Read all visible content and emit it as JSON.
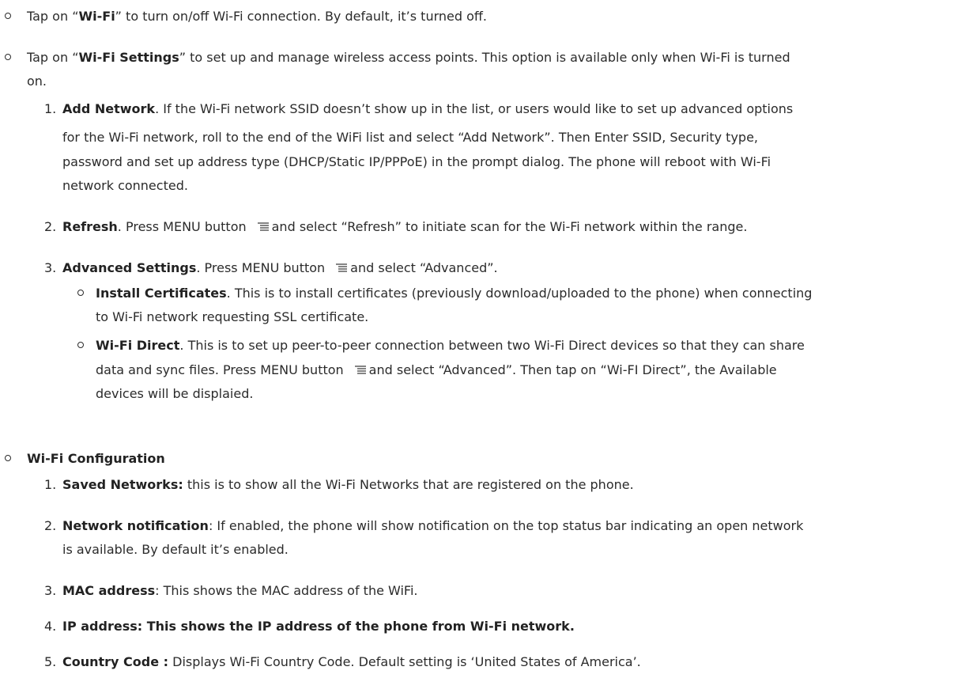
{
  "items": {
    "wifi": {
      "pre": "Tap on “",
      "bold": "Wi-Fi",
      "post": "” to turn on/off Wi-Fi connection. By default, it’s turned off."
    },
    "wifi_settings": {
      "pre": "Tap on “",
      "bold": "Wi-Fi Settings",
      "post_line1": "” to set up and manage wireless access points. This option is available only when Wi-Fi is turned",
      "post_line2": "on.",
      "sub": {
        "add_network": {
          "num": "1.",
          "bold": "Add Network",
          "line1": ". If the Wi-Fi network SSID doesn’t show up in the list, or users would like to set up advanced options",
          "line2": "for the Wi-Fi network, roll to the end of the WiFi list and select “Add Network”. Then Enter SSID, Security type,",
          "line3": "password and set up address type (DHCP/Static IP/PPPoE) in the prompt dialog. The phone will reboot with Wi-Fi",
          "line4": "network connected."
        },
        "refresh": {
          "num": "2.",
          "bold": "Refresh",
          "pre": ". Press MENU button",
          "post": "and select “Refresh” to initiate scan for the Wi-Fi network within the range."
        },
        "advanced": {
          "num": "3.",
          "bold": "Advanced Settings",
          "pre": ". Press MENU button",
          "post": "and select “Advanced”.",
          "install": {
            "bold": "Install Certificates",
            "line1": ". This is to install certificates (previously download/uploaded to the phone) when connecting",
            "line2": "to Wi-Fi network requesting SSL certificate."
          },
          "direct": {
            "bold": "Wi-Fi Direct",
            "line1": ". This is to set up peer-to-peer connection between two Wi-Fi Direct devices so that they can share",
            "line2_pre": "data and sync files. Press MENU button",
            "line2_post": "and select “Advanced”. Then tap on “Wi-FI Direct”, the Available",
            "line3": "devices will be displaied."
          }
        }
      }
    },
    "config": {
      "bold": "Wi-Fi Configuration",
      "saved": {
        "num": "1.",
        "bold": "Saved Networks:",
        "text": " this is to show all the Wi-Fi Networks that are registered on the phone."
      },
      "notif": {
        "num": "2.",
        "bold": "Network notification",
        "line1": ": If enabled, the phone will show notification on the top status bar indicating an open network",
        "line2": "is available. By default it’s enabled."
      },
      "mac": {
        "num": "3.",
        "bold": "MAC address",
        "text": ": This shows the MAC address of the WiFi."
      },
      "ip": {
        "num": "4.",
        "bold": "IP address: This shows the IP address of the phone from Wi-Fi network."
      },
      "country": {
        "num": "5.",
        "bold": "Country Code :",
        "text": " Displays Wi-Fi Country Code. Default setting is ‘United States of America’."
      }
    }
  },
  "icons": {
    "menu": "menu-icon"
  }
}
